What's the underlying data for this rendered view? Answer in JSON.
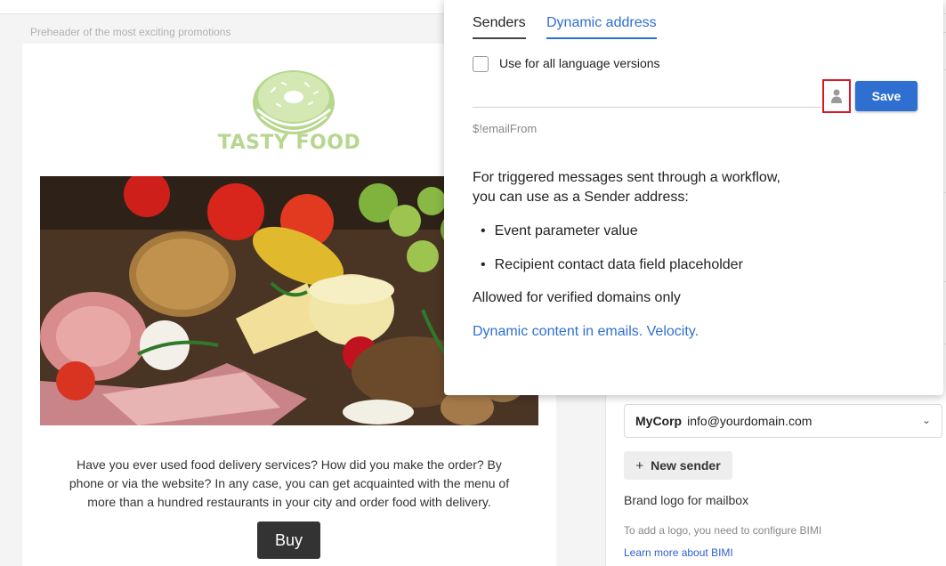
{
  "preheader": "Preheader of the most exciting promotions",
  "email": {
    "logo_text": "TASTY FOOD",
    "body_text": "Have you ever used food delivery services? How did you make the order? By phone or via the website? In any case, you can get acquainted with the menu of more than a hundred restaurants in your city and order food with delivery.",
    "buy_label": "Buy"
  },
  "popup": {
    "tabs": [
      {
        "label": "Senders",
        "active": false
      },
      {
        "label": "Dynamic address",
        "active": true
      }
    ],
    "checkbox_label": "Use for all language versions",
    "checkbox_checked": false,
    "save_label": "Save",
    "email_from_value": "$!emailFrom",
    "info_line1": "For triggered messages sent through a workflow,",
    "info_line2": "you can use as a Sender address:",
    "bullets": [
      "Event parameter value",
      "Recipient contact data field placeholder"
    ],
    "allowed_text": "Allowed for verified domains only",
    "velocity_link": "Dynamic content in emails. Velocity."
  },
  "right_panel": {
    "sender_name": "MyCorp",
    "sender_email": "info@yourdomain.com",
    "new_sender_label": "New sender",
    "brand_logo_label": "Brand logo for mailbox",
    "bimi_hint": "To add a logo, you need to configure BIMI",
    "bimi_link": "Learn more about BIMI"
  },
  "colors": {
    "accent": "#2f6fd1",
    "highlight_border": "#e0142a",
    "logo_green": "#b7d68e"
  }
}
